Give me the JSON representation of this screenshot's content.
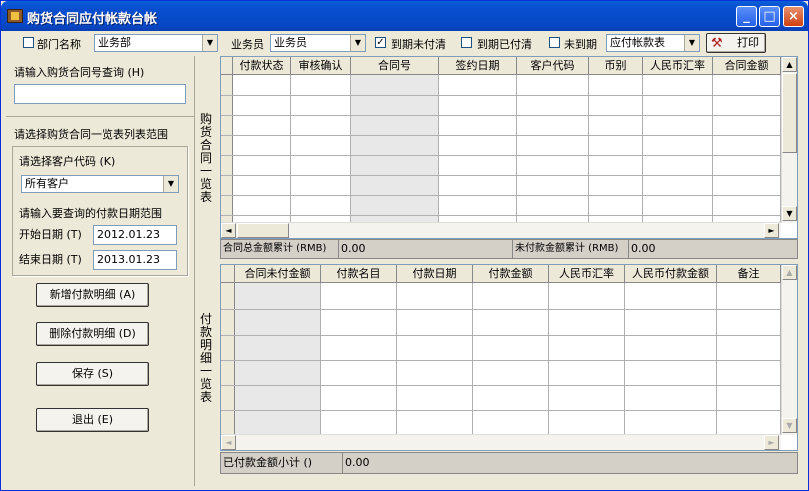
{
  "window": {
    "title": "购货合同应付帐款台帐"
  },
  "toolbar": {
    "dept_label": "部门名称",
    "dept_value": "业务部",
    "staff_label": "业务员",
    "staff_value": "业务员",
    "due_unpaid_label": "到期未付清",
    "due_paid_label": "到期已付清",
    "not_due_label": "未到期",
    "report_value": "应付帐款表",
    "print_label": "打印"
  },
  "left": {
    "contract_query_label": "请输入购货合同号查询 (H)",
    "contract_query_value": "",
    "range_label": "请选择购货合同一览表列表范围",
    "customer_label": "请选择客户代码 (K)",
    "customer_value": "所有客户",
    "date_range_label": "请输入要查询的付款日期范围",
    "start_label": "开始日期 (T)",
    "start_value": "2012.01.23",
    "end_label": "结束日期 (T)",
    "end_value": "2013.01.23",
    "btn_add": "新增付款明细 (A)",
    "btn_delete": "删除付款明细 (D)",
    "btn_save": "保存 (S)",
    "btn_exit": "退出 (E)"
  },
  "contracts": {
    "side_label": "购货合同一览表",
    "columns": [
      "付款状态",
      "审核确认",
      "合同号",
      "签约日期",
      "客户代码",
      "币别",
      "人民币汇率",
      "合同金额"
    ],
    "total_label": "合同总金额累计 (RMB)",
    "total_value": "0.00",
    "unpaid_label": "未付款金额累计 (RMB)",
    "unpaid_value": "0.00"
  },
  "payments": {
    "side_label": "付款明细一览表",
    "columns": [
      "合同未付金额",
      "付款名目",
      "付款日期",
      "付款金额",
      "人民币汇率",
      "人民币付款金额",
      "备注"
    ],
    "subtotal_label": "已付款金额小计 ()",
    "subtotal_value": "0.00"
  }
}
